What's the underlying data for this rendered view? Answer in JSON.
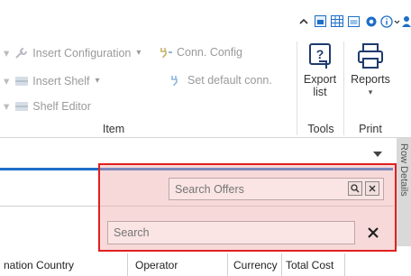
{
  "ribbon": {
    "item_group": {
      "insert_configuration": "Insert Configuration",
      "conn_config": "Conn. Config",
      "insert_shelf": "Insert Shelf",
      "set_default_conn": "Set default conn.",
      "shelf_editor": "Shelf Editor",
      "label": "Item"
    },
    "tools_group": {
      "export_list_line1": "Export",
      "export_list_line2": "list",
      "label": "Tools"
    },
    "print_group": {
      "reports": "Reports",
      "label": "Print"
    }
  },
  "side_tab": {
    "row_details": "Row Details"
  },
  "search": {
    "offers_placeholder": "Search Offers",
    "general_placeholder": "Search"
  },
  "grid": {
    "columns": [
      "nation Country",
      "Operator",
      "Currency",
      "Total Cost"
    ]
  },
  "colors": {
    "accent_blue": "#1e6ec8",
    "highlight_border": "#e02020"
  }
}
